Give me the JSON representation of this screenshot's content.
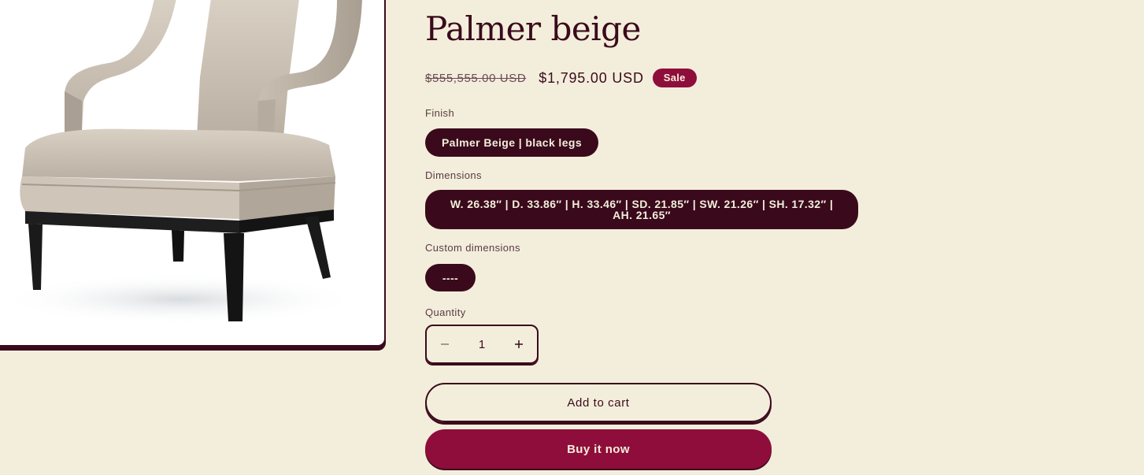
{
  "product": {
    "title": "Palmer beige",
    "image_icon": "armchair-image",
    "price_compare": "$555,555.00 USD",
    "price_sale": "$1,795.00 USD",
    "sale_badge": "Sale"
  },
  "options": {
    "finish": {
      "label": "Finish",
      "value": "Palmer Beige | black legs"
    },
    "dimensions": {
      "label": "Dimensions",
      "value": "W. 26.38″ | D. 33.86″ | H. 33.46″ | SD. 21.85″ | SW. 21.26″ | SH. 17.32″ | AH. 21.65″"
    },
    "custom_dimensions": {
      "label": "Custom dimensions",
      "value": "----"
    }
  },
  "quantity": {
    "label": "Quantity",
    "value": "1",
    "minus_icon": "minus-icon",
    "plus_icon": "plus-icon"
  },
  "actions": {
    "add_to_cart": "Add to cart",
    "buy_now": "Buy it now"
  },
  "colors": {
    "background": "#f3eedb",
    "primary": "#3a0a1c",
    "sale_accent": "#8f0d3b"
  }
}
